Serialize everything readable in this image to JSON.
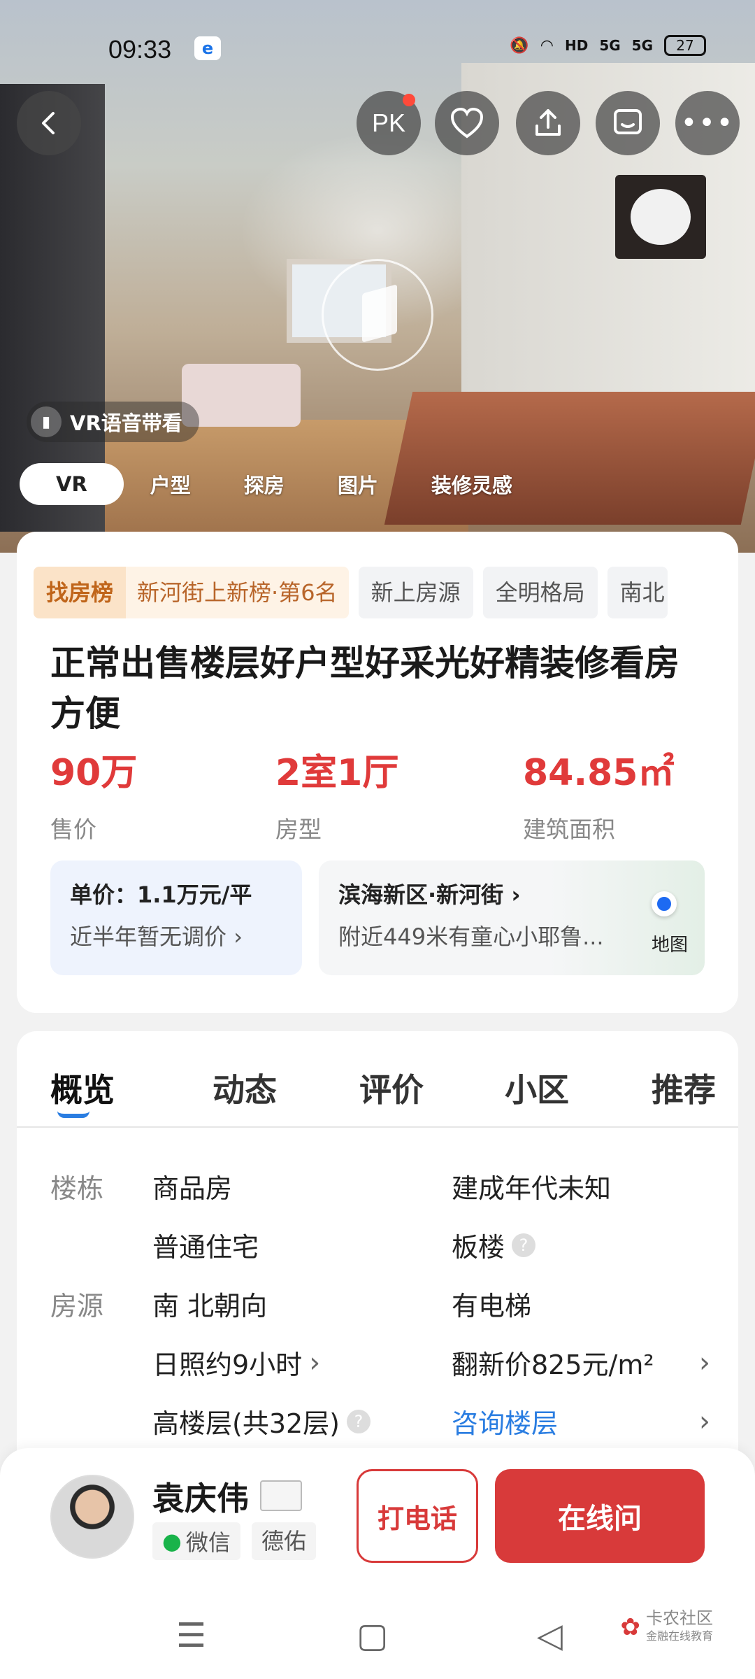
{
  "status": {
    "time": "09:33",
    "carrier_icon": "carrier-icon",
    "signals": [
      "HD",
      "5G",
      "5G"
    ],
    "battery": "27"
  },
  "top_actions": {
    "back_icon": "back-arrow-icon",
    "pk_label": "PK",
    "favorite_icon": "heart-icon",
    "share_icon": "share-icon",
    "message_icon": "message-icon",
    "more_icon": "more-icon"
  },
  "vr_voice": {
    "label": "VR语音带看"
  },
  "media_tabs": [
    "VR",
    "户型",
    "探房",
    "图片",
    "装修灵感"
  ],
  "listing": {
    "rank_tag": "找房榜",
    "rank_text": "新河街上新榜·第6名",
    "tags": [
      "新上房源",
      "全明格局",
      "南北"
    ],
    "title": "正常出售楼层好户型好采光好精装修看房方便",
    "stats": [
      {
        "value": "90万",
        "label": "售价"
      },
      {
        "value": "2室1厅",
        "label": "房型"
      },
      {
        "value": "84.85㎡",
        "label": "建筑面积"
      }
    ],
    "unit_price": "单价：1.1万元/平",
    "price_change": "近半年暂无调价",
    "location": "滨海新区·新河街",
    "nearby": "附近449米有童心小耶鲁...",
    "map_label": "地图"
  },
  "nav_tabs": [
    "概览",
    "动态",
    "评价",
    "小区",
    "推荐"
  ],
  "details": {
    "building_label": "楼栋",
    "source_label": "房源",
    "building_type": "商品房",
    "build_year": "建成年代未知",
    "usage": "普通住宅",
    "structure": "板楼",
    "orientation": "南 北朝向",
    "elevator": "有电梯",
    "sunlight": "日照约9小时",
    "renovation_price": "翻新价825元/m²",
    "floor": "高楼层(共32层)",
    "consult_floor": "咨询楼层"
  },
  "agent": {
    "name": "袁庆伟",
    "wechat": "微信",
    "company": "德佑",
    "call_label": "打电话",
    "chat_label": "在线问"
  },
  "watermark": "卡农社区",
  "watermark_sub": "金融在线教育"
}
